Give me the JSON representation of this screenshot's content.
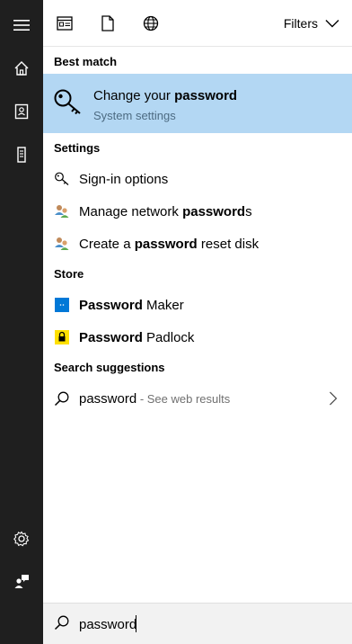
{
  "rail": {
    "items": [
      "hamburger-icon",
      "home-icon",
      "notebook-icon",
      "tower-icon",
      "settings-icon",
      "feedback-icon"
    ]
  },
  "topbar": {
    "icons": [
      "apps-icon",
      "documents-icon",
      "web-icon"
    ],
    "filters_label": "Filters"
  },
  "sections": {
    "best_match": "Best match",
    "settings": "Settings",
    "store": "Store",
    "suggestions": "Search suggestions"
  },
  "best_match": {
    "title_prefix": "Change your ",
    "title_bold": "password",
    "subtitle": "System settings"
  },
  "settings_items": [
    {
      "pre": "Sign-in options",
      "bold": "",
      "post": ""
    },
    {
      "pre": "Manage network ",
      "bold": "password",
      "post": "s"
    },
    {
      "pre": "Create a ",
      "bold": "password",
      "post": " reset disk"
    }
  ],
  "store_items": [
    {
      "bold": "Password",
      "post": " Maker"
    },
    {
      "bold": "Password",
      "post": " Padlock"
    }
  ],
  "suggestion": {
    "term": "password",
    "extra": " - See web results"
  },
  "search": {
    "value": "password"
  },
  "colors": {
    "rail_bg": "#1f1f1f",
    "highlight": "#b3d7f3",
    "maker_blue": "#0078d7",
    "padlock_yellow": "#ffe000"
  }
}
